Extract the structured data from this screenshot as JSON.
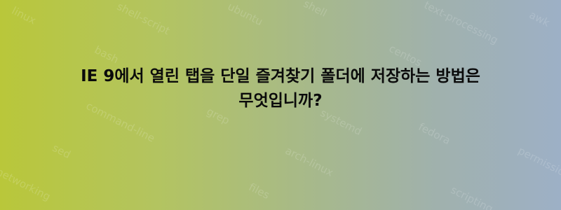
{
  "question": {
    "title_line1": "IE 9에서 열린 탭을 단일 즐겨찾기 폴더에 저장하는 방법은",
    "title_line2": "무엇입니까?"
  },
  "background_tags": [
    "linux",
    "shell-script",
    "ubuntu",
    "shell",
    "text-processing",
    "awk",
    "bash",
    "centos",
    "command-line",
    "grep",
    "systemd",
    "fedora",
    "sed",
    "networking",
    "arch-linux",
    "files",
    "permissions",
    "scripting"
  ],
  "colors": {
    "gradient_left": "#b9c73a",
    "gradient_right": "#9db0c6",
    "title_text": "#0b0b0b"
  }
}
